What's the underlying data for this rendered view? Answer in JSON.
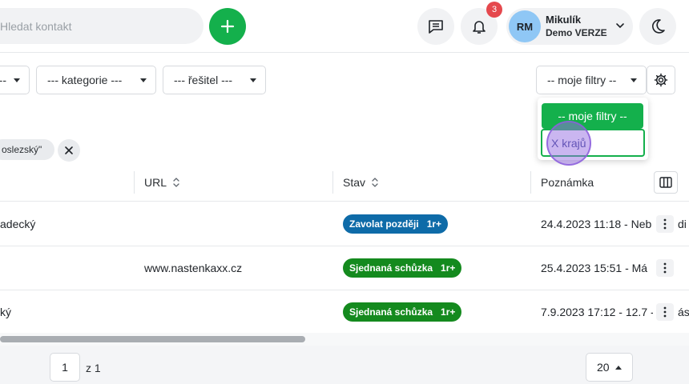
{
  "header": {
    "search_placeholder": "Hledat kontakt",
    "notifications_count": "3",
    "user": {
      "initials": "RM",
      "name": "Mikulík",
      "subtitle": "Demo VERZE"
    }
  },
  "filters": {
    "select_left_label": "---",
    "category_label": "--- kategorie ---",
    "solver_label": "--- řešitel ---",
    "my_filters_label": "-- moje filtry --",
    "dropdown": {
      "selected": "-- moje filtry --",
      "options": [
        "X krajů"
      ]
    }
  },
  "active_filter_chip": "oslezský\"",
  "table": {
    "columns": [
      "URL",
      "Stav",
      "Poznámka"
    ],
    "rows": [
      {
        "name": "adecký",
        "url": "",
        "status": "Zavolat později",
        "status_ext": "1r+",
        "status_color": "#0e6ba8",
        "note": "24.4.2023 11:18 - Neb",
        "overflow": "di"
      },
      {
        "name": "",
        "url": "www.nastenkaxx.cz",
        "status": "Sjednaná schůzka",
        "status_ext": "1r+",
        "status_color": "#148a1e",
        "note": "25.4.2023 15:51 - Má",
        "overflow": ""
      },
      {
        "name": "ký",
        "url": "",
        "status": "Sjednaná schůzka",
        "status_ext": "1r+",
        "status_color": "#148a1e",
        "note": "7.9.2023 17:12 - 12.7 -",
        "overflow": "ás"
      }
    ]
  },
  "pagination": {
    "current_page": "1",
    "total_label": "z 1",
    "page_size": "20"
  },
  "colors": {
    "accent_green": "#14b04c",
    "badge_red": "#e5484d",
    "status_blue": "#0e6ba8",
    "status_green": "#148a1e"
  }
}
